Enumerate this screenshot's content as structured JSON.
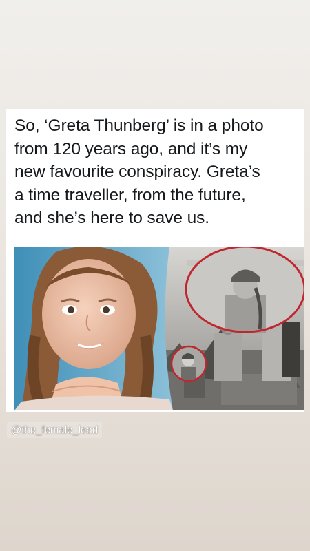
{
  "post": {
    "caption_lines": [
      "So, ‘Greta Thunberg’ is in a photo",
      "from 120 years ago, and it’s my",
      "new favourite conspiracy. Greta’s",
      "a time traveller, from the future,",
      "and she’s here to save us."
    ],
    "image_subject": "Greta Thunberg portrait beside a 1898 historical photo with circled figure",
    "highlight_color": "#c0262e"
  },
  "story": {
    "mention": "@the_female_lead"
  }
}
